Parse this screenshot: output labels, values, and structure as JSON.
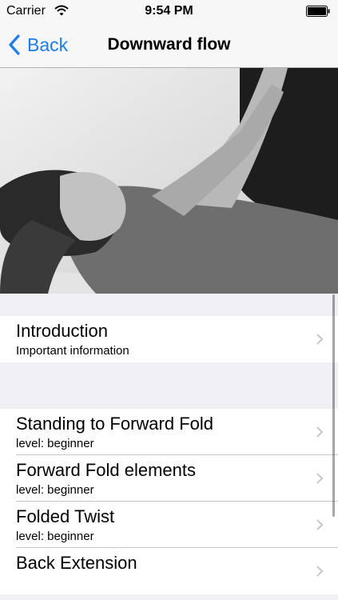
{
  "status_bar": {
    "carrier": "Carrier",
    "time": "9:54 PM"
  },
  "nav": {
    "back_label": "Back",
    "title": "Downward flow"
  },
  "hero": {
    "image": "black-and-white photo of a woman lying on her back, arms raised"
  },
  "sections": [
    {
      "rows": [
        {
          "title": "Introduction",
          "subtitle": "Important information"
        }
      ]
    },
    {
      "rows": [
        {
          "title": "Standing to Forward Fold",
          "subtitle": "level: beginner"
        },
        {
          "title": "Forward Fold elements",
          "subtitle": "level: beginner"
        },
        {
          "title": "Folded Twist",
          "subtitle": "level: beginner"
        },
        {
          "title": "Back Extension",
          "subtitle": ""
        }
      ]
    }
  ],
  "colors": {
    "accent": "#1a7ef1",
    "background": "#efeff4"
  },
  "icons": {
    "wifi": "wifi-icon",
    "battery": "battery-icon",
    "back": "chevron-left-icon",
    "disclosure": "chevron-right-icon"
  }
}
